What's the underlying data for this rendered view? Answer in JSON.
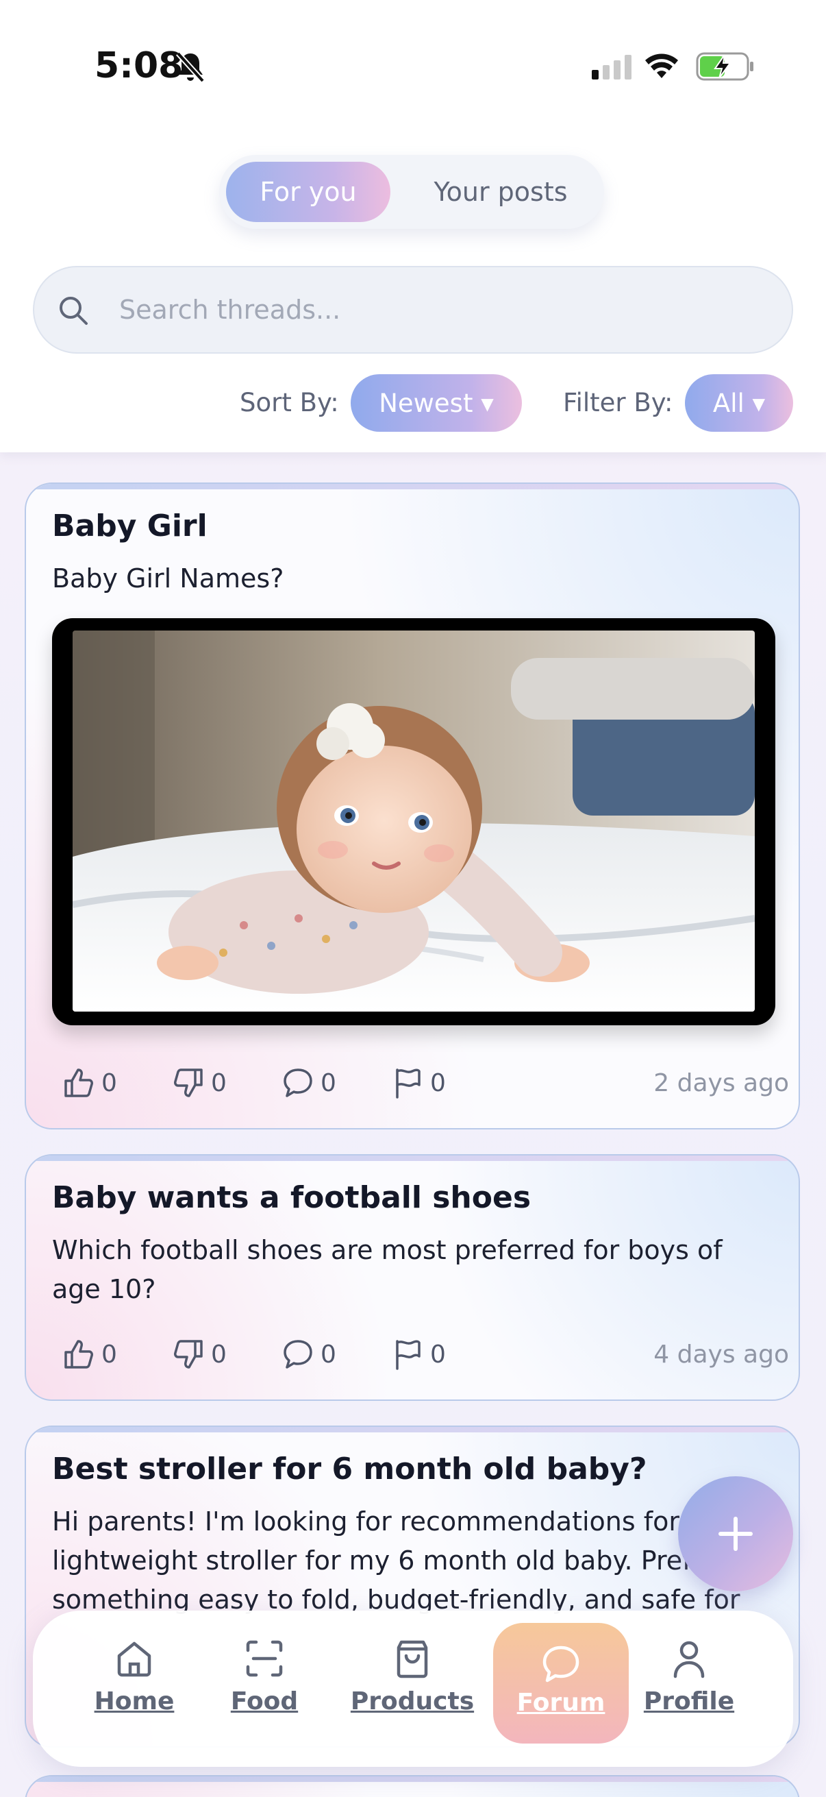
{
  "status_bar": {
    "time": "5:08"
  },
  "tabs": {
    "active": "For you",
    "other": "Your posts"
  },
  "search": {
    "placeholder": "Search threads..."
  },
  "sort": {
    "label": "Sort By:",
    "value": "Newest ▾"
  },
  "filter": {
    "label": "Filter By:",
    "value": "All ▾"
  },
  "posts": [
    {
      "title": "Baby Girl",
      "body": "Baby Girl Names?",
      "likes": "0",
      "dislikes": "0",
      "comments": "0",
      "flags": "0",
      "time_ago": "2 days ago"
    },
    {
      "title": "Baby wants a football shoes",
      "body": "Which football shoes are most preferred for boys of age 10?",
      "likes": "0",
      "dislikes": "0",
      "comments": "0",
      "flags": "0",
      "time_ago": "4 days ago"
    },
    {
      "title": "Best stroller for 6 month old baby?",
      "body": "Hi parents! I'm looking for recommendations for a lightweight stroller for my 6 month old baby. Prefer something easy to fold, budget-friendly, and safe for"
    }
  ],
  "fab": {
    "icon": "plus-icon"
  },
  "nav": {
    "home": "Home",
    "food": "Food",
    "products": "Products",
    "forum": "Forum",
    "profile": "Profile"
  }
}
